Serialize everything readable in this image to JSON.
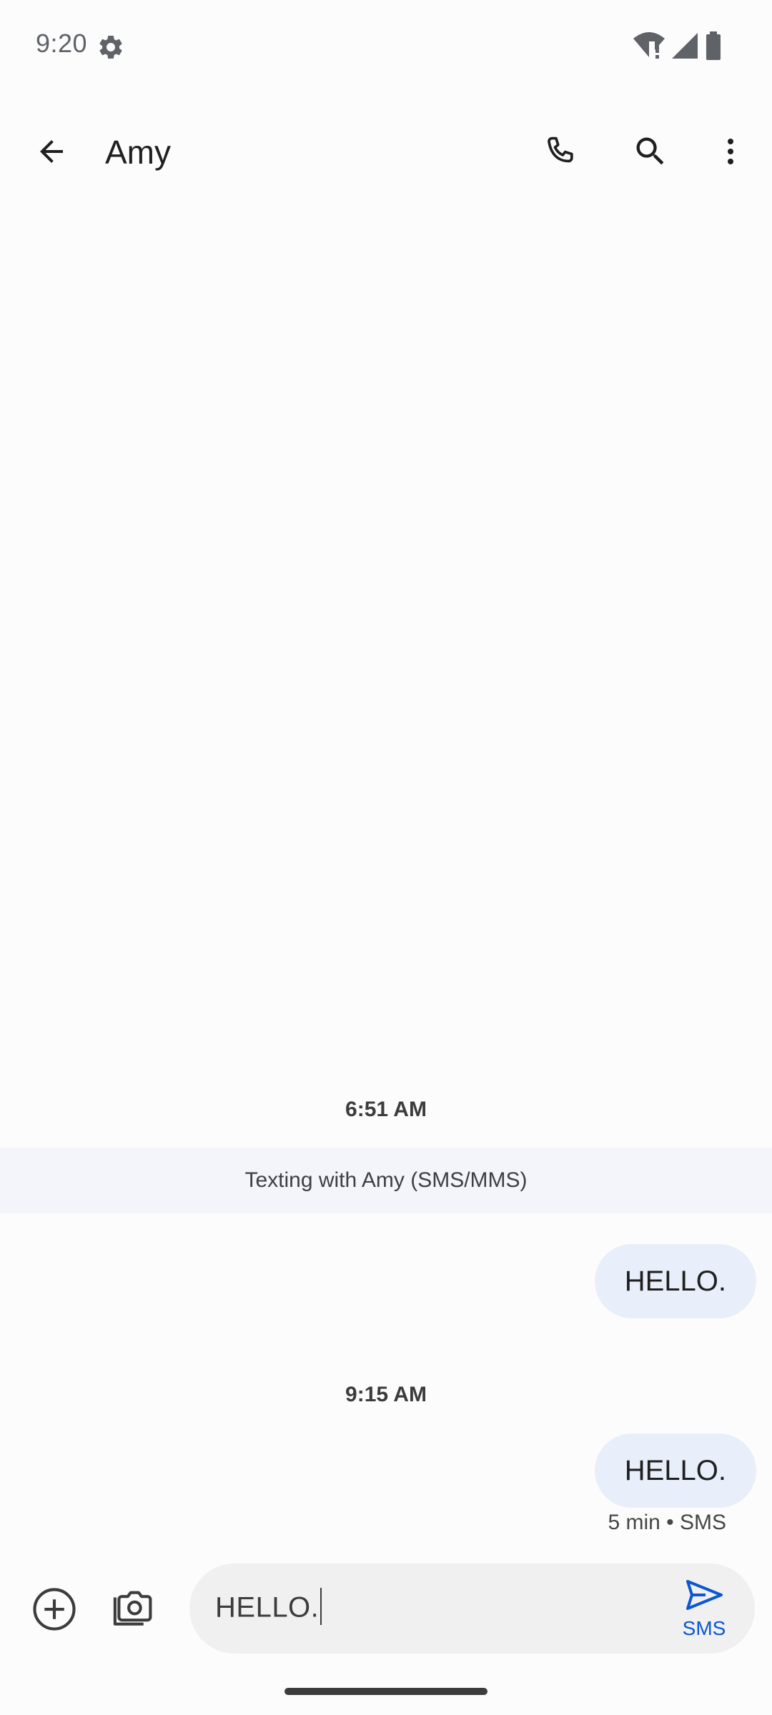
{
  "status_bar": {
    "time": "9:20",
    "icons": [
      "settings-gear-icon",
      "wifi-alert-icon",
      "cell-signal-icon",
      "battery-icon"
    ]
  },
  "app_bar": {
    "title": "Amy",
    "icons": [
      "back-arrow-icon",
      "phone-icon",
      "search-icon",
      "more-vert-icon"
    ]
  },
  "conversation": {
    "groups": [
      {
        "timestamp": "6:51 AM",
        "banner": "Texting with Amy (SMS/MMS)",
        "message": "HELLO."
      },
      {
        "timestamp": "9:15 AM",
        "message": "HELLO.",
        "meta": "5 min • SMS"
      }
    ]
  },
  "compose": {
    "icons": [
      "add-circle-icon",
      "camera-gallery-icon",
      "send-icon"
    ],
    "input_value": "HELLO.",
    "send_label": "SMS"
  },
  "colors": {
    "background": "#fdfcfd",
    "bubble": "#e8eefa",
    "banner": "#f3f5fa",
    "accent": "#0b57d0",
    "input": "#f0f0f0"
  }
}
